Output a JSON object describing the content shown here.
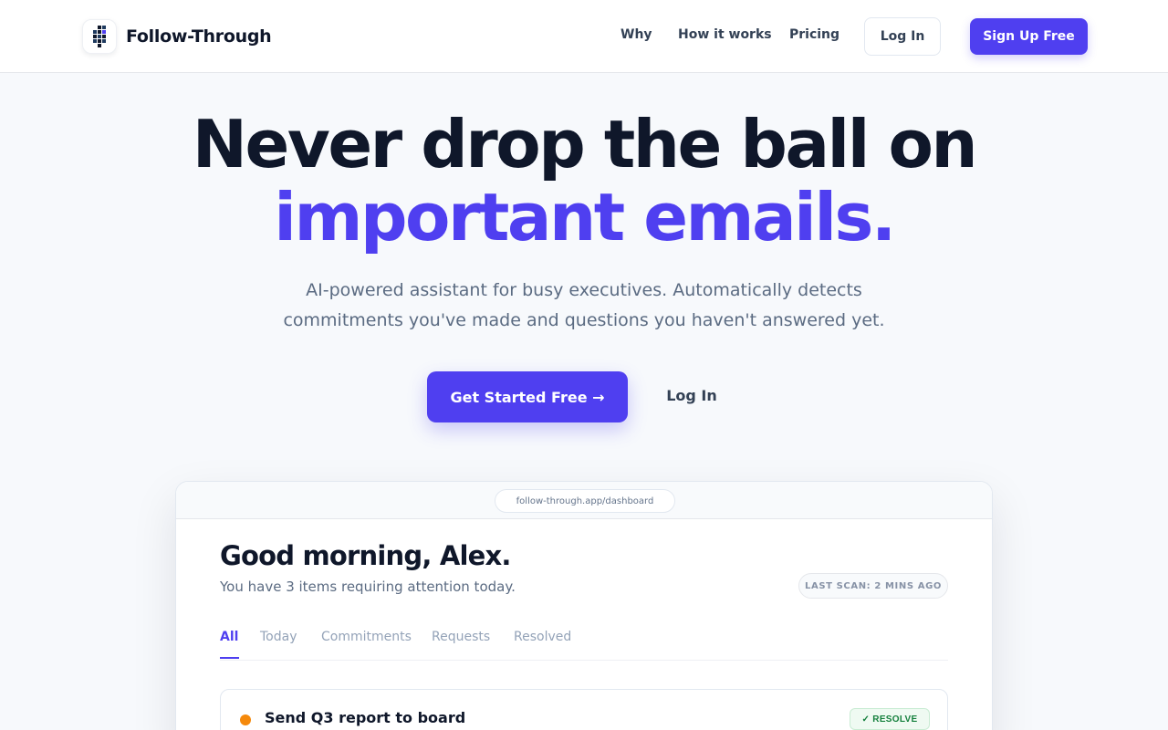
{
  "nav": {
    "brand_name": "Follow-Through",
    "links": [
      "Why",
      "How it works",
      "Pricing"
    ],
    "login_label": "Log In",
    "signup_label": "Sign Up Free"
  },
  "hero": {
    "title_line1": "Never drop the ball on",
    "title_line2": "important emails.",
    "subtitle": "AI-powered assistant for busy executives. Automatically detects commitments you've made and questions you haven't answered yet.",
    "cta_label": "Get Started Free →",
    "login_label": "Log In"
  },
  "preview": {
    "url": "follow-through.app/dashboard",
    "greeting": "Good morning, Alex.",
    "subtext": "You have 3 items requiring attention today.",
    "scan_badge": "LAST SCAN: 2 MINS AGO",
    "tabs": [
      "All",
      "Today",
      "Commitments",
      "Requests",
      "Resolved"
    ],
    "active_tab": "All",
    "items": [
      {
        "title": "Send Q3 report to board",
        "action_label": "✓ RESOLVE",
        "status_color": "#f5890b"
      }
    ]
  },
  "colors": {
    "accent": "#4f3ff0",
    "text_dark": "#0f172a",
    "text_muted": "#5b6b82",
    "success": "#15803d",
    "warning": "#f5890b"
  }
}
